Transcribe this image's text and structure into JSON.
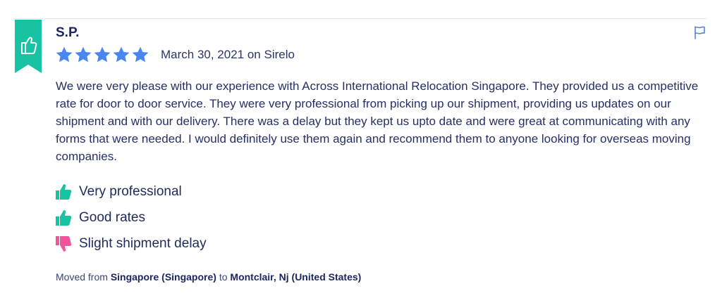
{
  "review": {
    "reviewer": "S.P.",
    "rating": 5,
    "rating_max": 5,
    "date_source": "March 30, 2021 on Sirelo",
    "text": "We were very please with our experience with Across International Relocation Singapore. They provided us a competitive rate for door to door service. They were very professional from picking up our shipment, providing us updates on our shipment and with our delivery. There was a delay but they kept us upto date and were great at communicating with any forms that were needed. I would definitely use them again and recommend them to anyone looking for overseas moving companies.",
    "points": [
      {
        "label": "Very professional",
        "kind": "positive",
        "icon": "thumbs-up-icon"
      },
      {
        "label": "Good rates",
        "kind": "positive",
        "icon": "thumbs-up-icon"
      },
      {
        "label": "Slight shipment delay",
        "kind": "negative",
        "icon": "thumbs-down-icon"
      }
    ],
    "moved": {
      "prefix": "Moved from",
      "from": "Singapore (Singapore)",
      "connector": "to",
      "to": "Montclair, Nj (United States)"
    }
  },
  "icons": {
    "ribbon": "thumbs-up-ribbon-icon",
    "report": "flag-icon",
    "star": "star-icon"
  },
  "colors": {
    "ribbon": "#17c3a3",
    "star": "#4a86ef",
    "positive": "#17c3a3",
    "negative": "#f0559b",
    "flag": "#4a86ef",
    "text": "#1f2a5c"
  }
}
